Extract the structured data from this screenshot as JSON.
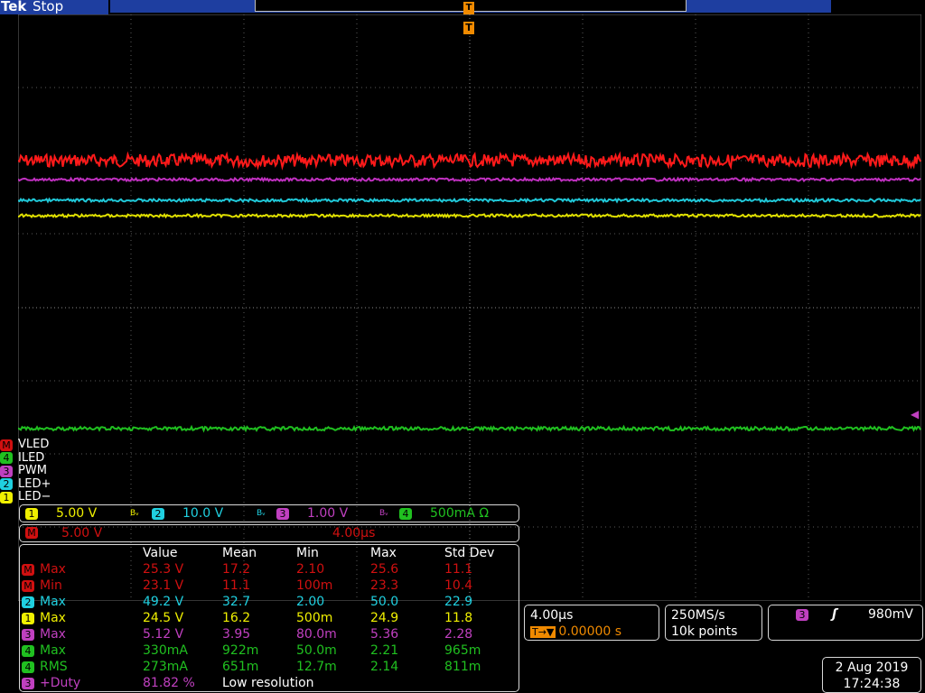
{
  "brand": {
    "name": "Tek",
    "run_state": "Stop"
  },
  "trigger_marker": "T",
  "channel_labels": [
    {
      "badge": "M",
      "name": "VLED",
      "color": "#d01010"
    },
    {
      "badge": "4",
      "name": "ILED",
      "color": "#20c020"
    },
    {
      "badge": "3",
      "name": "PWM",
      "color": "#c040c0"
    },
    {
      "badge": "2",
      "name": "LED+",
      "color": "#20d0e0"
    },
    {
      "badge": "1",
      "name": "LED−",
      "color": "#f0f000"
    }
  ],
  "vertical_scale": {
    "ch1": {
      "badge": "1",
      "value": "5.00 V",
      "color": "#f0f000"
    },
    "ch2": {
      "badge": "2",
      "value": "10.0 V",
      "color": "#20d0e0"
    },
    "ch3": {
      "badge": "3",
      "value": "1.00 V",
      "color": "#c040c0"
    },
    "ch4": {
      "badge": "4",
      "value": "500mA Ω",
      "color": "#20c020"
    },
    "bw_symbol": "Bᵥ"
  },
  "math_scale": {
    "badge": "M",
    "volts": "5.00 V",
    "time": "4.00µs"
  },
  "measurements": {
    "headers": [
      "",
      "Value",
      "Mean",
      "Min",
      "Max",
      "Std Dev"
    ],
    "rows": [
      {
        "badge": "M",
        "color": "#d01010",
        "label": "Max",
        "value": "25.3 V",
        "mean": "17.2",
        "min": "2.10",
        "max": "25.6",
        "std": "11.1"
      },
      {
        "badge": "M",
        "color": "#d01010",
        "label": "Min",
        "value": "23.1 V",
        "mean": "11.1",
        "min": "100m",
        "max": "23.3",
        "std": "10.4"
      },
      {
        "badge": "2",
        "color": "#20d0e0",
        "label": "Max",
        "value": "49.2 V",
        "mean": "32.7",
        "min": "2.00",
        "max": "50.0",
        "std": "22.9"
      },
      {
        "badge": "1",
        "color": "#f0f000",
        "label": "Max",
        "value": "24.5 V",
        "mean": "16.2",
        "min": "500m",
        "max": "24.9",
        "std": "11.8"
      },
      {
        "badge": "3",
        "color": "#c040c0",
        "label": "Max",
        "value": "5.12 V",
        "mean": "3.95",
        "min": "80.0m",
        "max": "5.36",
        "std": "2.28"
      },
      {
        "badge": "4",
        "color": "#20c020",
        "label": "Max",
        "value": "330mA",
        "mean": "922m",
        "min": "50.0m",
        "max": "2.21",
        "std": "965m"
      },
      {
        "badge": "4",
        "color": "#20c020",
        "label": "RMS",
        "value": "273mA",
        "mean": "651m",
        "min": "12.7m",
        "max": "2.14",
        "std": "811m"
      },
      {
        "badge": "3",
        "color": "#c040c0",
        "label": "+Duty",
        "value": "81.82 %",
        "note": "Low resolution"
      }
    ]
  },
  "horizontal": {
    "scale": "4.00µs",
    "delay_label": "T→▼",
    "delay": "0.00000 s"
  },
  "acquisition": {
    "rate": "250MS/s",
    "record": "10k points"
  },
  "trigger": {
    "badge": "3",
    "slope": "ʃ",
    "level": "980mV"
  },
  "datetime": {
    "date": "2 Aug 2019",
    "time": "17:24:38"
  }
}
